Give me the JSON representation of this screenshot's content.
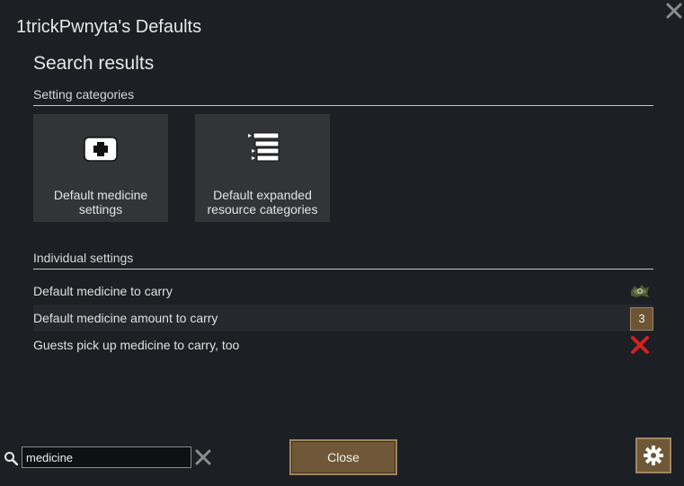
{
  "window": {
    "title": "1trickPwnyta's Defaults",
    "close_icon": "close-x-icon"
  },
  "search_results": {
    "title": "Search results",
    "categories_header": "Setting categories",
    "categories": [
      {
        "label": "Default medicine settings",
        "icon": "medical-kit-icon"
      },
      {
        "label": "Default expanded resource categories",
        "icon": "expand-list-icon"
      }
    ],
    "individual_header": "Individual settings",
    "settings": [
      {
        "label": "Default medicine to carry",
        "control": "medicine-herbal-icon"
      },
      {
        "label": "Default medicine amount to carry",
        "value": "3"
      },
      {
        "label": "Guests pick up medicine to carry, too",
        "control": "red-x-icon"
      }
    ]
  },
  "bottom_bar": {
    "search_icon": "search-icon",
    "search_value": "medicine",
    "clear_icon": "clear-x-icon",
    "close_label": "Close",
    "gear_icon": "gear-icon"
  },
  "colors": {
    "background": "#1c1f23",
    "card": "#333437",
    "button": "#6e5837",
    "button_border": "#a08660",
    "red_x": "#d42020"
  }
}
